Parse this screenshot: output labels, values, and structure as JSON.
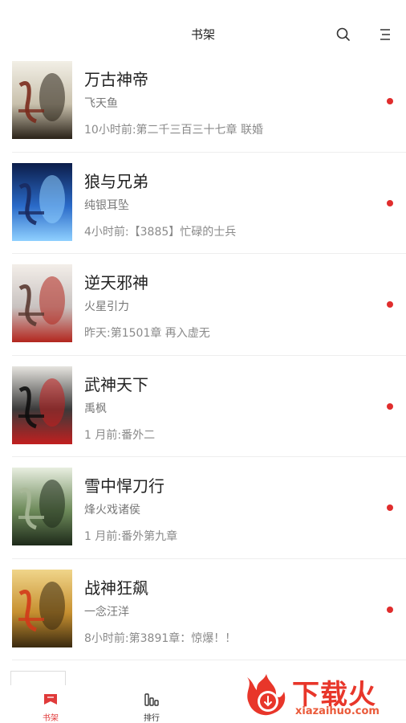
{
  "header": {
    "title": "书架"
  },
  "books": [
    {
      "title": "万古神帝",
      "author": "飞天鱼",
      "update": "10小时前:第二千三百三十七章 联婚",
      "cover_palette": [
        "#f2efe6",
        "#c9c1ad",
        "#2a2218",
        "#7a2b1d"
      ]
    },
    {
      "title": "狼与兄弟",
      "author": "纯银耳坠",
      "update": "4小时前:【3885】忙碌的士兵",
      "cover_palette": [
        "#0c1d4a",
        "#2a6ac8",
        "#8fd0ff",
        "#1a2a60"
      ]
    },
    {
      "title": "逆天邪神",
      "author": "火星引力",
      "update": "昨天:第1501章 再入虚无",
      "cover_palette": [
        "#f3eee9",
        "#c8c2c0",
        "#b3261e",
        "#5a3a32"
      ]
    },
    {
      "title": "武神天下",
      "author": "禹枫",
      "update": "1 月前:番外二",
      "cover_palette": [
        "#e6e4df",
        "#3a3a3a",
        "#c21f1f",
        "#0e0e0e"
      ]
    },
    {
      "title": "雪中悍刀行",
      "author": "烽火戏诸侯",
      "update": "1 月前:番外第九章",
      "cover_palette": [
        "#e8eee0",
        "#6d8a5a",
        "#1e2a1a",
        "#a8b898"
      ]
    },
    {
      "title": "战神狂飙",
      "author": "一念汪洋",
      "update": "8小时前:第3891章：惊爆！！",
      "cover_palette": [
        "#f0d58a",
        "#c79030",
        "#3a2a10",
        "#d23a1a"
      ]
    }
  ],
  "tabbar": {
    "bookshelf_label": "书架",
    "ranking_label": "排行"
  },
  "watermark": {
    "text": "下载火",
    "url": "xiazaihuo.com"
  },
  "colors": {
    "accent": "#e02d2d",
    "divider": "#eeeeee"
  }
}
